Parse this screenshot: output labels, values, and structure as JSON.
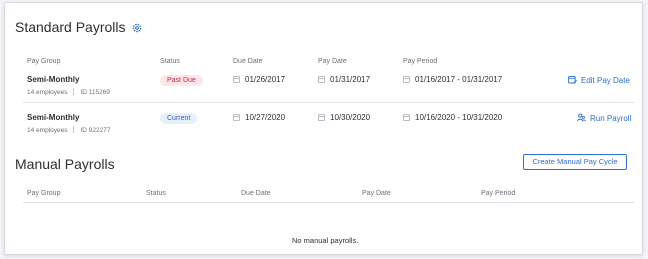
{
  "standard": {
    "title": "Standard Payrolls",
    "columns": [
      "Pay Group",
      "Status",
      "Due Date",
      "Pay Date",
      "Pay Period"
    ],
    "rows": [
      {
        "name": "Semi-Monthly",
        "employees": "14 employees",
        "id": "ID 115269",
        "status": "Past Due",
        "due_date": "01/26/2017",
        "pay_date": "01/31/2017",
        "pay_period": "01/16/2017 - 01/31/2017",
        "action": "Edit Pay Date"
      },
      {
        "name": "Semi-Monthly",
        "employees": "14 employees",
        "id": "ID 922277",
        "status": "Current",
        "due_date": "10/27/2020",
        "pay_date": "10/30/2020",
        "pay_period": "10/16/2020 - 10/31/2020",
        "action": "Run Payroll"
      }
    ]
  },
  "manual": {
    "title": "Manual Payrolls",
    "create_button": "Create Manual Pay Cycle",
    "columns": [
      "Pay Group",
      "Status",
      "Due Date",
      "Pay Date",
      "Pay Period"
    ],
    "empty_message": "No manual payrolls."
  },
  "colors": {
    "accent": "#2e6fd6",
    "past_due_bg": "#fde7ea",
    "past_due_text": "#c8283e",
    "current_bg": "#e6f0fd",
    "current_text": "#2e5dbf"
  },
  "icons": {
    "settings": "gear-icon",
    "date": "calendar-icon",
    "edit_pay_date": "calendar-edit-icon",
    "run_payroll": "people-icon"
  }
}
